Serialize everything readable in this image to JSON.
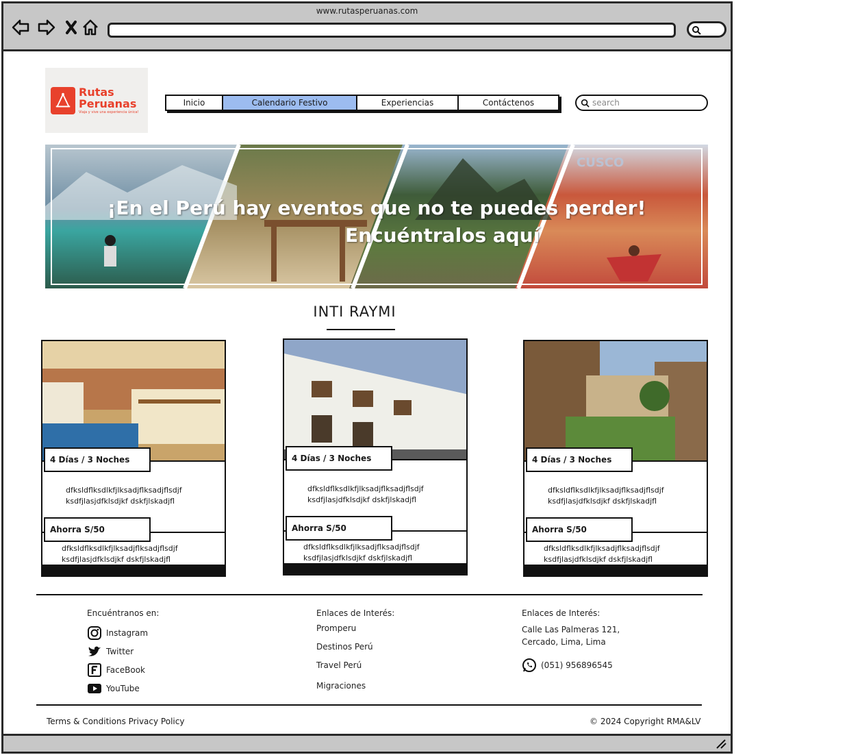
{
  "browser": {
    "url": "www.rutasperuanas.com"
  },
  "logo": {
    "line1": "Rutas",
    "line2": "Peruanas",
    "tagline": "Viaja y vive una experiencia única!"
  },
  "menu": [
    {
      "label": "Inicio",
      "active": false
    },
    {
      "label": "Calendario Festivo",
      "active": true
    },
    {
      "label": "Experiencias",
      "active": false
    },
    {
      "label": "Contáctenos",
      "active": false
    }
  ],
  "search": {
    "placeholder": "search"
  },
  "hero": {
    "line1": "¡En el Perú hay eventos que no te puedes perder!",
    "line2": "Encuéntralos aquí",
    "badge": "CUSCO"
  },
  "section": {
    "title": "INTI RAYMI"
  },
  "cards": [
    {
      "duration": "4 Días / 3 Noches",
      "desc1": "dfksldflksdlkfjlksadjflksadjflsdjf ksdfjlasjdfklsdjkf dskfjlskadjfl",
      "price": "Ahorra S/50",
      "desc2": "dfksldflksdlkfjlksadjflksadjflsdjf ksdfjlasjdfklsdjkf dskfjlskadjfl"
    },
    {
      "duration": "4 Días / 3 Noches",
      "desc1": "dfksldflksdlkfjlksadjflksadjflsdjf ksdfjlasjdfklsdjkf dskfjlskadjfl",
      "price": "Ahorra S/50",
      "desc2": "dfksldflksdlkfjlksadjflksadjflsdjf ksdfjlasjdfklsdjkf dskfjlskadjfl"
    },
    {
      "duration": "4 Días / 3 Noches",
      "desc1": "dfksldflksdlkfjlksadjflksadjflsdjf ksdfjlasjdfklsdjkf dskfjlskadjfl",
      "price": "Ahorra S/50",
      "desc2": "dfksldflksdlkfjlksadjflksadjflsdjf ksdfjlasjdfklsdjkf dskfjlskadjfl"
    }
  ],
  "footer": {
    "social": {
      "heading": "Encuéntranos en:",
      "items": [
        {
          "label": "Instagram",
          "icon": "instagram-icon"
        },
        {
          "label": "Twitter",
          "icon": "twitter-icon"
        },
        {
          "label": "FaceBook",
          "icon": "facebook-icon"
        },
        {
          "label": "YouTube",
          "icon": "youtube-icon"
        }
      ]
    },
    "links": {
      "heading": "Enlaces de Interés:",
      "items": [
        "Promperu",
        "Destinos Perú",
        "Travel Perú",
        "Migraciones"
      ]
    },
    "contact": {
      "heading": "Enlaces de Interés:",
      "address_line1": "Calle Las Palmeras 121,",
      "address_line2": "Cercado, Lima, Lima",
      "phone": "(051) 956896545"
    },
    "legal": "Terms & Conditions Privacy Policy",
    "copyright": "© 2024 Copyright RMA&LV"
  },
  "colors": {
    "brand": "#e8412c",
    "menu_active": "#9cbcf0",
    "chrome": "#c7c7c7"
  }
}
